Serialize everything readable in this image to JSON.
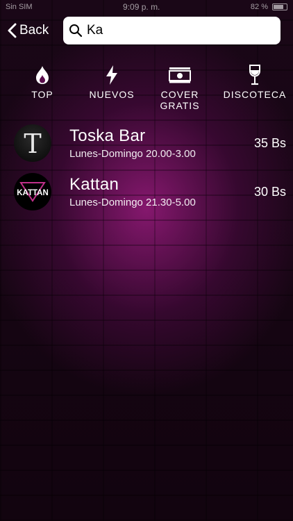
{
  "status": {
    "carrier": "Sin SIM",
    "time": "9:09 p. m.",
    "battery": "82 %"
  },
  "nav": {
    "back_label": "Back"
  },
  "search": {
    "value": "Ka"
  },
  "categories": [
    {
      "label": "TOP",
      "icon": "flame-icon"
    },
    {
      "label": "NUEVOS",
      "icon": "lightning-icon"
    },
    {
      "label": "COVER\nGRATIS",
      "icon": "cash-icon"
    },
    {
      "label": "DISCOTECA",
      "icon": "wine-glass-icon"
    }
  ],
  "results": [
    {
      "name": "Toska Bar",
      "hours": "Lunes-Domingo 20.00-3.00",
      "price": "35 Bs",
      "logo_text": "T"
    },
    {
      "name": "Kattan",
      "hours": "Lunes-Domingo 21.30-5.00",
      "price": "30 Bs",
      "logo_text": "KATTAN"
    }
  ],
  "colors": {
    "accent": "#a8148a",
    "background": "#12060f"
  }
}
